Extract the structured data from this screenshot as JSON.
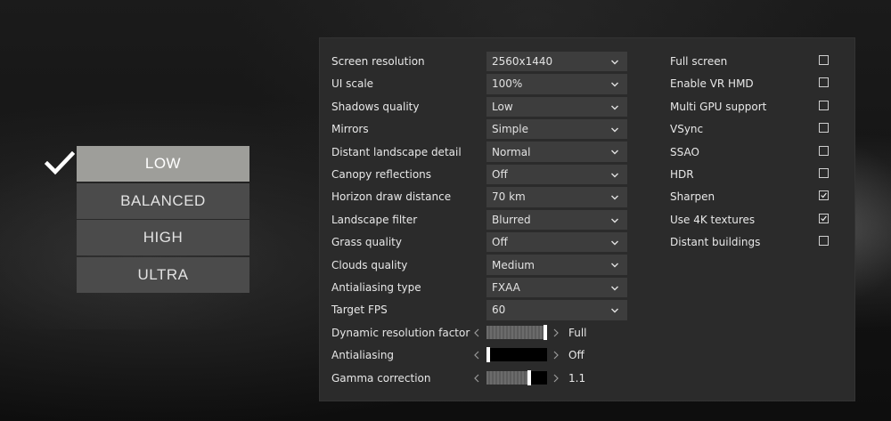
{
  "presets": {
    "items": [
      {
        "label": "LOW",
        "active": true
      },
      {
        "label": "BALANCED",
        "active": false
      },
      {
        "label": "HIGH",
        "active": false
      },
      {
        "label": "ULTRA",
        "active": false
      }
    ]
  },
  "settings": {
    "dropdowns": [
      {
        "label": "Screen resolution",
        "value": "2560x1440"
      },
      {
        "label": "UI scale",
        "value": "100%"
      },
      {
        "label": "Shadows quality",
        "value": "Low"
      },
      {
        "label": "Mirrors",
        "value": "Simple"
      },
      {
        "label": "Distant landscape detail",
        "value": "Normal"
      },
      {
        "label": "Canopy reflections",
        "value": "Off"
      },
      {
        "label": "Horizon draw distance",
        "value": "70 km"
      },
      {
        "label": "Landscape filter",
        "value": "Blurred"
      },
      {
        "label": "Grass quality",
        "value": "Off"
      },
      {
        "label": "Clouds quality",
        "value": "Medium"
      },
      {
        "label": "Antialiasing type",
        "value": "FXAA"
      },
      {
        "label": "Target FPS",
        "value": "60"
      }
    ],
    "sliders": [
      {
        "label": "Dynamic resolution factor",
        "value_text": "Full",
        "level": 1.0
      },
      {
        "label": "Antialiasing",
        "value_text": "Off",
        "level": 0.0
      },
      {
        "label": "Gamma correction",
        "value_text": "1.1",
        "level": 0.72
      }
    ],
    "checkboxes": [
      {
        "label": "Full screen",
        "checked": false
      },
      {
        "label": "Enable VR HMD",
        "checked": false
      },
      {
        "label": "Multi GPU support",
        "checked": false
      },
      {
        "label": "VSync",
        "checked": false
      },
      {
        "label": "SSAO",
        "checked": false
      },
      {
        "label": "HDR",
        "checked": false
      },
      {
        "label": "Sharpen",
        "checked": true
      },
      {
        "label": "Use 4K textures",
        "checked": true
      },
      {
        "label": "Distant buildings",
        "checked": false
      }
    ]
  },
  "icons": {
    "preset_selected": "check-icon",
    "dropdown": "chevron-down-icon",
    "slider_left": "chevron-left-icon",
    "slider_right": "chevron-right-icon"
  },
  "colors": {
    "panel_bg": "#2b2b2b",
    "dropdown_bg": "#3d3d3d",
    "preset_bg": "#4b4b4b",
    "preset_active_bg": "#9e9e9a"
  }
}
